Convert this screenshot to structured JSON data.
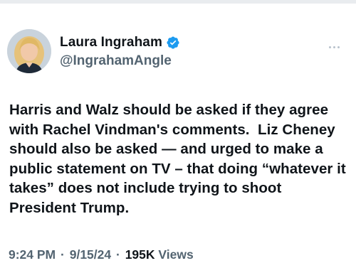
{
  "tweet": {
    "author": {
      "display_name": "Laura Ingraham",
      "handle": "@IngrahamAngle",
      "verified": true,
      "verified_badge_color": "#1d9bf0",
      "avatar_icon": "profile-photo"
    },
    "more_icon": "ellipsis-icon",
    "text": "Harris and Walz should be asked if they agree with Rachel Vindman's comments.  Liz Cheney should also be asked — and urged to make a public statement on TV – that doing “whatever it takes” does not include trying to shoot President Trump.",
    "time": "9:24 PM",
    "date": "9/15/24",
    "separator": "·",
    "views_count": "195K",
    "views_label": "Views"
  }
}
